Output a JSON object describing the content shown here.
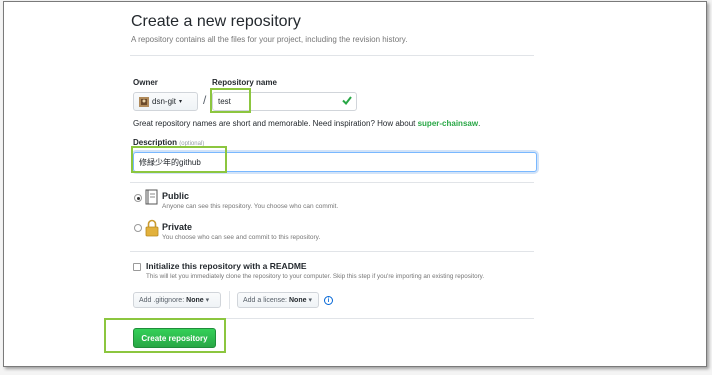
{
  "page": {
    "title": "Create a new repository",
    "subtitle": "A repository contains all the files for your project, including the revision history."
  },
  "owner": {
    "label": "Owner",
    "value": "dsn-git",
    "caret": "▾"
  },
  "repo": {
    "label": "Repository name",
    "separator": "/",
    "value": "test"
  },
  "hint": {
    "text": "Great repository names are short and memorable. Need inspiration? How about ",
    "suggestion": "super-chainsaw",
    "end": "."
  },
  "description": {
    "label": "Description",
    "optional": "(optional)",
    "value": "修緑少年的github"
  },
  "visibility": {
    "public": {
      "title": "Public",
      "desc": "Anyone can see this repository. You choose who can commit.",
      "selected": true
    },
    "private": {
      "title": "Private",
      "desc": "You choose who can see and commit to this repository.",
      "selected": false
    }
  },
  "init": {
    "title": "Initialize this repository with a README",
    "desc": "This will let you immediately clone the repository to your computer. Skip this step if you're importing an existing repository.",
    "checked": false
  },
  "gitignore": {
    "prefix": "Add .gitignore:",
    "value": "None",
    "caret": "▾"
  },
  "license": {
    "prefix": "Add a license:",
    "value": "None",
    "caret": "▾"
  },
  "info_icon": "i",
  "submit": {
    "label": "Create repository"
  },
  "colors": {
    "accent_green": "#28a745",
    "highlight": "#8cc63f",
    "focus_blue": "#79b8ff"
  }
}
